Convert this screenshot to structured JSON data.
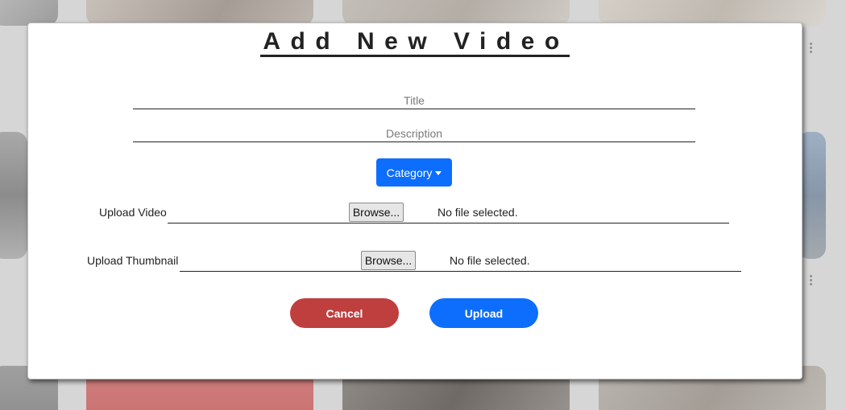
{
  "modal": {
    "title": "Add New Video",
    "title_field": {
      "placeholder": "Title",
      "value": ""
    },
    "description_field": {
      "placeholder": "Description",
      "value": ""
    },
    "category_button": {
      "label": "Category"
    },
    "upload_video": {
      "label": "Upload Video",
      "browse_label": "Browse...",
      "status": "No file selected."
    },
    "upload_thumbnail": {
      "label": "Upload Thumbnail",
      "browse_label": "Browse...",
      "status": "No file selected."
    },
    "cancel_button": {
      "label": "Cancel"
    },
    "upload_button": {
      "label": "Upload"
    }
  },
  "colors": {
    "primary": "#0d6efd",
    "danger": "#bf3f3f",
    "backdrop": "#d6d6d6"
  },
  "icons": {
    "category_caret": "caret-down-icon",
    "thumbnail_menu": "kebab-menu-icon"
  }
}
